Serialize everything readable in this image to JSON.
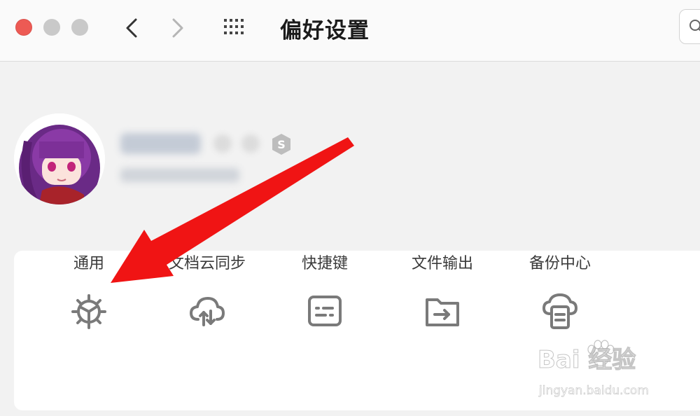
{
  "window": {
    "title": "偏好设置"
  },
  "toolbar": {
    "back": "chevron-left-icon",
    "forward": "chevron-right-icon",
    "apps": "grid-icon",
    "search": "search-icon"
  },
  "profile": {
    "avatar": "anime-avatar",
    "badge": "S",
    "name_obscured": true
  },
  "settings": {
    "items": [
      {
        "label": "通用",
        "icon": "gear-icon"
      },
      {
        "label": "文档云同步",
        "icon": "cloud-sync-icon"
      },
      {
        "label": "快捷键",
        "icon": "keyboard-icon"
      },
      {
        "label": "文件输出",
        "icon": "folder-export-icon"
      },
      {
        "label": "备份中心",
        "icon": "backup-icon"
      }
    ]
  },
  "watermark": {
    "brand": "Bai 经验",
    "url": "jingyan.baidu.com"
  },
  "colors": {
    "close": "#ed5a54",
    "arrow": "#f01414",
    "icon": "#7a7a7a"
  }
}
